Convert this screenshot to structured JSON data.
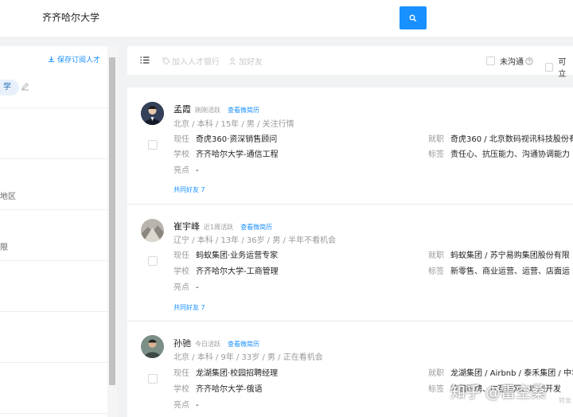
{
  "search": {
    "query": "齐齐哈尔大学"
  },
  "sidebar": {
    "save_subscription": "保存订阅人才",
    "school_tag": "学",
    "text_region": "地区",
    "text_limit": "限"
  },
  "toolbar": {
    "add_bank": "加入人才银行",
    "add_friend": "加好友",
    "not_contacted": "未沟通",
    "available": "可立"
  },
  "candidates": [
    {
      "name": "孟霞",
      "activity": "刚刚活跃",
      "view_resume": "查看微简历",
      "meta": "北京 / 本科 / 15年 / 男 / 关注行情",
      "current_label": "现任",
      "current": "奇虎360·资深销售顾问",
      "school_label": "学校",
      "school": "齐齐哈尔大学-通信工程",
      "highlight_label": "亮点",
      "highlight": "-",
      "past_label": "就职",
      "past": "奇虎360 / 北京数码视讯科技股份有",
      "tags_label": "标签",
      "tags": "责任心、抗压能力、沟通协调能力",
      "friends": "共同好友 7"
    },
    {
      "name": "崔宇峰",
      "activity": "近1周活跃",
      "view_resume": "查看微简历",
      "meta": "辽宁 / 本科 / 13年 / 36岁 / 男 / 半年不看机会",
      "current_label": "现任",
      "current": "蚂蚁集团·业务运营专家",
      "school_label": "学校",
      "school": "齐齐哈尔大学-工商管理",
      "highlight_label": "亮点",
      "highlight": "-",
      "past_label": "就职",
      "past": "蚂蚁集团 / 苏宁易购集团股份有限",
      "tags_label": "标签",
      "tags": "新零售、商业运营、运营、店面运",
      "friends": "共同好友 7"
    },
    {
      "name": "孙驰",
      "activity": "今日活跃",
      "view_resume": "查看微简历",
      "meta": "北京 / 本科 / 9年 / 33岁 / 男 / 正在看机会",
      "current_label": "现任",
      "current": "龙湖集团·校园招聘经理",
      "school_label": "学校",
      "school": "齐齐哈尔大学-俄语",
      "highlight_label": "亮点",
      "highlight": "-",
      "past_label": "就职",
      "past": "龙湖集团 / Airbnb / 泰禾集团 / 中华",
      "tags_label": "标签",
      "tags": "校园招聘、IT互联网、培训开发",
      "friends": ""
    }
  ],
  "watermark": {
    "main": "知乎 @雷空桑",
    "sub": "转发"
  },
  "colors": {
    "accent": "#1890ff",
    "tag_bg": "#e8f1fb",
    "page_bg": "#f1f2f4"
  },
  "icons": [
    "search-icon",
    "download-icon",
    "edit-icon",
    "list-icon",
    "tag-icon",
    "user-add-icon",
    "help-icon"
  ]
}
